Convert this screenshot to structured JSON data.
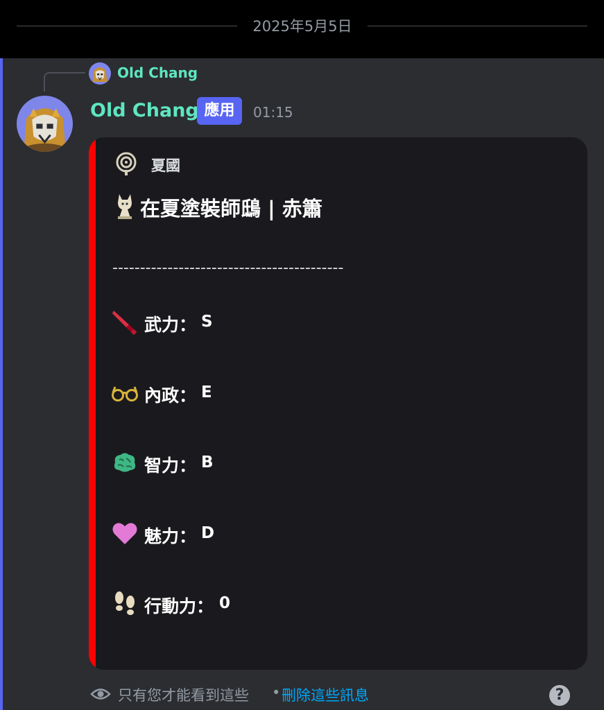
{
  "date_divider": {
    "text": "2025年5月5日"
  },
  "reply": {
    "author_name": "Old Chang"
  },
  "message": {
    "author_name": "Old Chang",
    "badge_label": "應用",
    "timestamp": "01:15"
  },
  "embed": {
    "accent_color": "#ff0000",
    "author_name": "夏國",
    "author_icon": "spiral-emblem-icon",
    "title_icon": "ghost-figure-icon",
    "title": "在夏塗裝師鴟 | 赤簫",
    "divider": "------------------------------------------",
    "stats": [
      {
        "icon": "dagger-icon",
        "label": "武力：",
        "value": "S"
      },
      {
        "icon": "glasses-icon",
        "label": "內政：",
        "value": "E"
      },
      {
        "icon": "brain-icon",
        "label": "智力：",
        "value": "B"
      },
      {
        "icon": "heart-icon",
        "label": "魅力：",
        "value": "D"
      },
      {
        "icon": "footprints-icon",
        "label": "行動力：",
        "value": "0"
      }
    ]
  },
  "ephemeral": {
    "text": "只有您才能看到這些",
    "separator": "•",
    "dismiss_label": "刪除這些訊息"
  },
  "help": {
    "label": "?"
  }
}
